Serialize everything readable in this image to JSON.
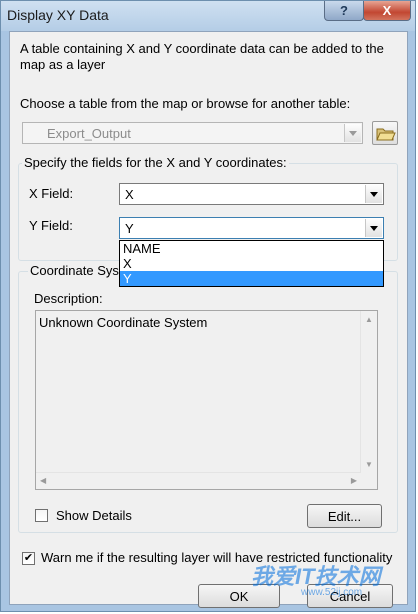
{
  "window": {
    "title": "Display XY Data"
  },
  "caption_buttons": {
    "help": "?",
    "close": "X"
  },
  "intro_text": "A table containing X and Y coordinate data can be added to the map as a layer",
  "choose_label": "Choose a table from the map or browse for another table:",
  "table_combo": {
    "value": "Export_Output",
    "enabled": false
  },
  "fields_group": {
    "legend": "Specify the fields for the X and Y coordinates:",
    "x_label": "X Field:",
    "x_value": "X",
    "y_label": "Y Field:",
    "y_value": "Y",
    "y_options": [
      "NAME",
      "X",
      "Y"
    ],
    "y_selected_index": 2
  },
  "coord_group": {
    "legend": "Coordinate Syst",
    "description_label": "Description:",
    "description_text": "Unknown Coordinate System",
    "show_details_label": "Show Details",
    "show_details_checked": false,
    "edit_button": "Edit..."
  },
  "warn": {
    "label": "Warn me if the resulting layer will have restricted functionality",
    "checked": true
  },
  "buttons": {
    "ok": "OK",
    "cancel": "Cancel"
  },
  "watermark": {
    "main": "我爱IT技术网",
    "sub": "www.52ij.com"
  },
  "colors": {
    "selection": "#3399ff",
    "close_red": "#c24732",
    "frame_blue": "#a9c5e2"
  }
}
